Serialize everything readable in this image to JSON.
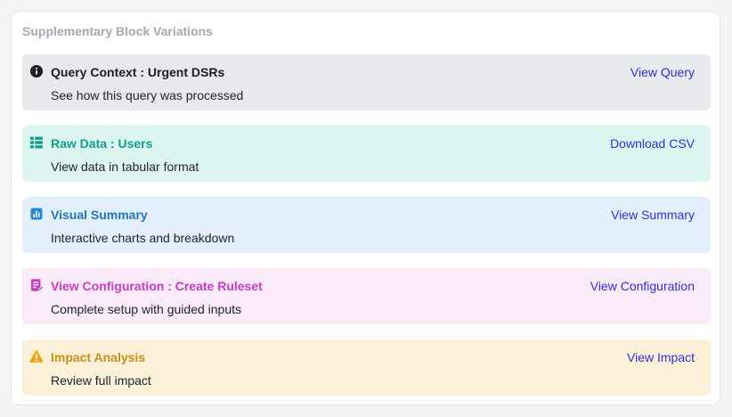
{
  "section_title": "Supplementary Block Variations",
  "blocks": [
    {
      "id": "query-context",
      "icon": "info-icon",
      "title": "Query Context : Urgent DSRs",
      "description": "See how this query was processed",
      "action": "View Query",
      "bg_color": "#e8e9ec",
      "title_color": "#1a1d21",
      "icon_color": "#1a1d21"
    },
    {
      "id": "raw-data",
      "icon": "table-grid-icon",
      "title": "Raw Data : Users",
      "description": "View data in tabular format",
      "action": "Download CSV",
      "bg_color": "#ddf5f1",
      "title_color": "#0f9e8c",
      "icon_color": "#0f9e8c"
    },
    {
      "id": "visual-summary",
      "icon": "bar-chart-icon",
      "title": "Visual Summary",
      "description": "Interactive charts and breakdown",
      "action": "View Summary",
      "bg_color": "#e3effc",
      "title_color": "#1f75b8",
      "icon_color": "#2b86d8"
    },
    {
      "id": "view-configuration",
      "icon": "clipboard-edit-icon",
      "title": "View Configuration : Create Ruleset",
      "description": "Complete setup with guided inputs",
      "action": "View Configuration",
      "bg_color": "#faeafa",
      "title_color": "#c83cc4",
      "icon_color": "#c83cc4"
    },
    {
      "id": "impact-analysis",
      "icon": "warning-triangle-icon",
      "title": "Impact Analysis",
      "description": "Review full impact",
      "action": "View Impact",
      "bg_color": "#fcf0d8",
      "title_color": "#c89010",
      "icon_color": "#e8a912"
    }
  ],
  "colors": {
    "action_link": "#2f2fd6",
    "section_title": "#a3a8b3"
  }
}
